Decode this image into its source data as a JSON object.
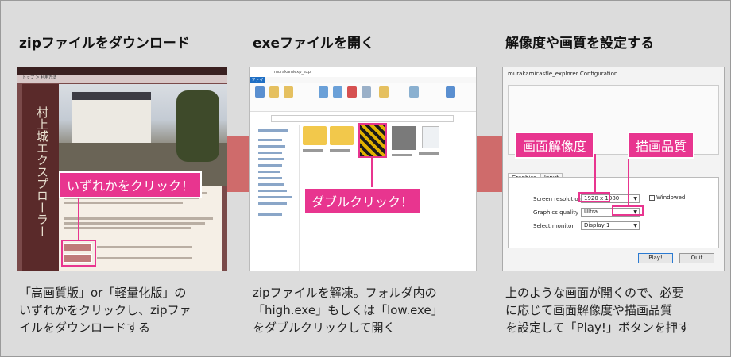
{
  "steps": [
    {
      "title": "zipファイルをダウンロード",
      "desc": [
        "「高画質版」or「軽量化版」の",
        "いずれかをクリックし、zipファ",
        "イルをダウンロードする"
      ],
      "callout": "いずれかをクリック！",
      "site": {
        "vertical_title": "村上城エクスプローラー",
        "crumb": "トップ ＞ 利用方法"
      }
    },
    {
      "title": "exeファイルを開く",
      "desc": [
        "zipファイルを解凍。フォルダ内の",
        "「high.exe」もしくは「low.exe」",
        "をダブルクリックして開く"
      ],
      "callout": "ダブルクリック！",
      "explorer": {
        "window_title": "murakamiexp_exp",
        "file_tab": "ファイル"
      }
    },
    {
      "title": "解像度や画質を設定する",
      "desc": [
        "上のような画面が開くので、必要",
        "に応じて画面解像度や描画品質",
        "を設定して「Play!」ボタンを押す"
      ],
      "callout_resolution": "画面解像度",
      "callout_quality": "描画品質",
      "dialog": {
        "title": "murakamicastle_explorer Configuration",
        "tab_graphics": "Graphics",
        "tab_input": "Input",
        "screen_resolution_label": "Screen resolution",
        "screen_resolution_value": "1920 x 1080",
        "graphics_quality_label": "Graphics quality",
        "graphics_quality_value": "Ultra",
        "select_monitor_label": "Select monitor",
        "select_monitor_value": "Display 1",
        "windowed_label": "Windowed",
        "play_button": "Play!",
        "quit_button": "Quit"
      }
    }
  ],
  "colors": {
    "accent_pink": "#e8358f",
    "connector": "#cf6b6b",
    "background": "#dcdcdc"
  }
}
